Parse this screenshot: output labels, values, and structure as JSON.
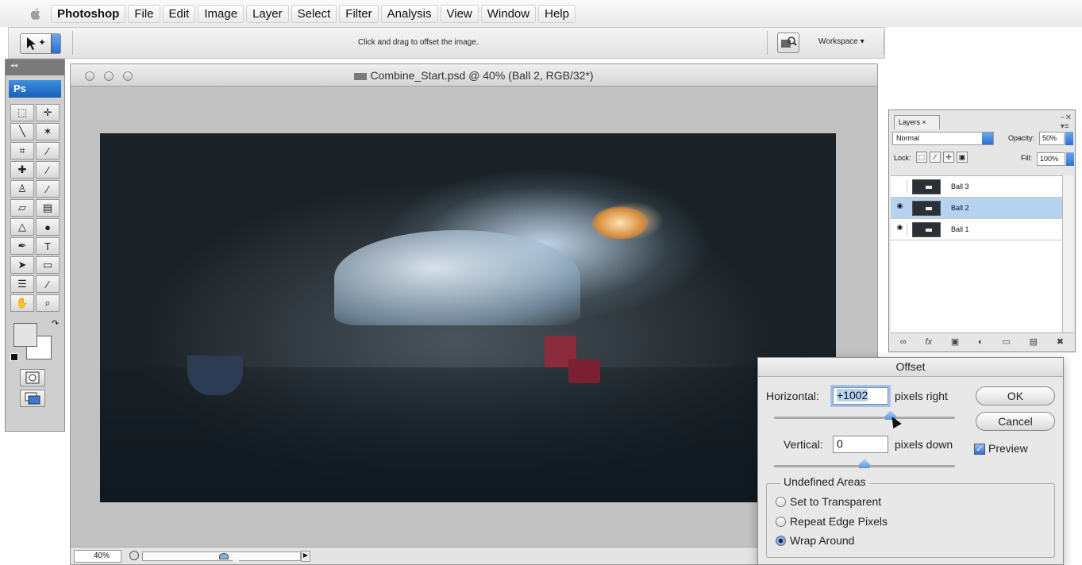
{
  "menubar": {
    "app_name": "Photoshop",
    "items": [
      "File",
      "Edit",
      "Image",
      "Layer",
      "Select",
      "Filter",
      "Analysis",
      "View",
      "Window",
      "Help"
    ]
  },
  "options_bar": {
    "hint": "Click and drag to offset the image.",
    "workspace_label": "Workspace ▾"
  },
  "toolbox": {
    "collapse_glyph": "◂◂",
    "logo": "Ps",
    "tools": [
      {
        "name": "marquee-tool-icon",
        "glyph": "⬚"
      },
      {
        "name": "move-tool-icon",
        "glyph": "✛"
      },
      {
        "name": "lasso-tool-icon",
        "glyph": "╲"
      },
      {
        "name": "magic-wand-tool-icon",
        "glyph": "✶"
      },
      {
        "name": "crop-tool-icon",
        "glyph": "⌗"
      },
      {
        "name": "slice-tool-icon",
        "glyph": "∕"
      },
      {
        "name": "healing-brush-tool-icon",
        "glyph": "✚"
      },
      {
        "name": "brush-tool-icon",
        "glyph": "∕"
      },
      {
        "name": "clone-stamp-tool-icon",
        "glyph": "♙"
      },
      {
        "name": "history-brush-tool-icon",
        "glyph": "∕"
      },
      {
        "name": "eraser-tool-icon",
        "glyph": "▱"
      },
      {
        "name": "gradient-tool-icon",
        "glyph": "▤"
      },
      {
        "name": "blur-tool-icon",
        "glyph": "△"
      },
      {
        "name": "dodge-tool-icon",
        "glyph": "●"
      },
      {
        "name": "pen-tool-icon",
        "glyph": "✒"
      },
      {
        "name": "type-tool-icon",
        "glyph": "T"
      },
      {
        "name": "path-selection-tool-icon",
        "glyph": "➤"
      },
      {
        "name": "shape-tool-icon",
        "glyph": "▭"
      },
      {
        "name": "notes-tool-icon",
        "glyph": "☰"
      },
      {
        "name": "eyedropper-tool-icon",
        "glyph": "∕"
      },
      {
        "name": "hand-tool-icon",
        "glyph": "✋"
      },
      {
        "name": "zoom-tool-icon",
        "glyph": "⌕"
      }
    ]
  },
  "document": {
    "title": "Combine_Start.psd @ 40% (Ball 2, RGB/32*)",
    "zoom": "40%"
  },
  "layers_panel": {
    "tab_label": "Layers ×",
    "blend_mode": "Normal",
    "opacity_label": "Opacity:",
    "opacity_value": "50%",
    "lock_label": "Lock:",
    "fill_label": "Fill:",
    "fill_value": "100%",
    "layers": [
      {
        "name": "Ball 3",
        "visible": false,
        "selected": false
      },
      {
        "name": "Ball 2",
        "visible": true,
        "selected": true
      },
      {
        "name": "Ball 1",
        "visible": true,
        "selected": false
      }
    ]
  },
  "offset_dialog": {
    "title": "Offset",
    "horizontal_label": "Horizontal:",
    "horizontal_value": "+1002",
    "horizontal_unit": "pixels right",
    "vertical_label": "Vertical:",
    "vertical_value": "0",
    "vertical_unit": "pixels down",
    "ok_label": "OK",
    "cancel_label": "Cancel",
    "preview_label": "Preview",
    "preview_checked": true,
    "undefined_areas_label": "Undefined Areas",
    "options": [
      {
        "label": "Set to Transparent",
        "selected": false
      },
      {
        "label": "Repeat Edge Pixels",
        "selected": false
      },
      {
        "label": "Wrap Around",
        "selected": true
      }
    ]
  },
  "colors": {
    "accent": "#3a78d0",
    "selection": "#b5d3f1"
  }
}
